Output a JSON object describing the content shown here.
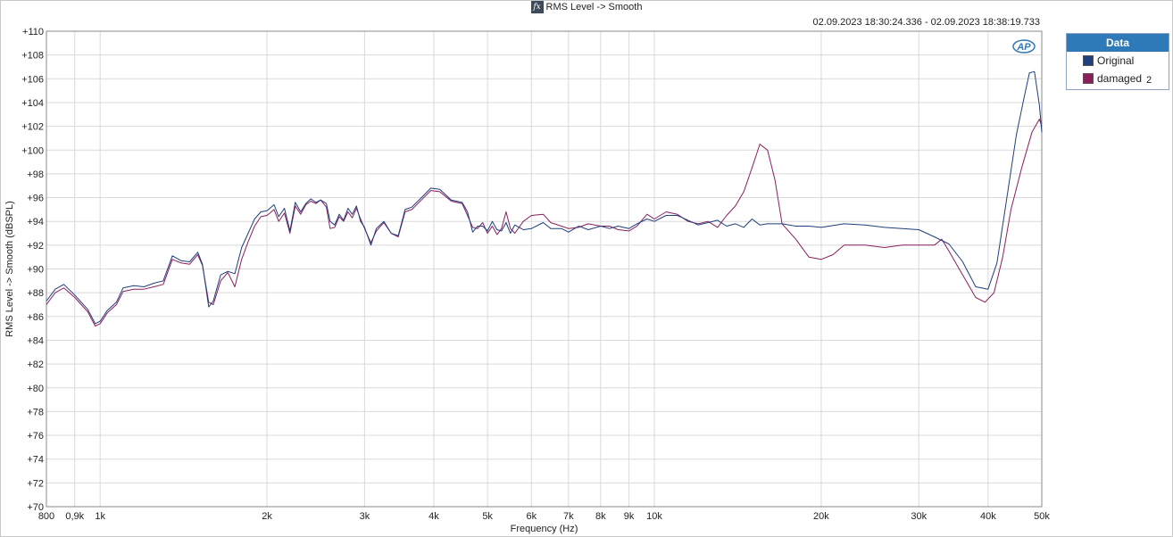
{
  "window": {
    "title": "RMS Level -> Smooth",
    "time_range": "02.09.2023 18:30:24.336 - 02.09.2023 18:38:19.733",
    "fx_icon": "fx-icon"
  },
  "legend": {
    "header": "Data",
    "items": [
      {
        "label": "Original",
        "suffix": "",
        "color": "#1f3e7c"
      },
      {
        "label": "damaged",
        "suffix": "2",
        "color": "#8a1f5e"
      }
    ]
  },
  "logo": {
    "text": "AP",
    "color": "#2e7ab8"
  },
  "chart_data": {
    "type": "line",
    "xlabel": "Frequency (Hz)",
    "ylabel": "RMS Level -> Smooth (dBSPL)",
    "xscale": "log",
    "xlim": [
      800,
      50000
    ],
    "ylim": [
      70,
      110
    ],
    "grid": true,
    "legend_position": "right",
    "x_ticks": [
      {
        "value": 800,
        "label": "800"
      },
      {
        "value": 900,
        "label": "0,9k"
      },
      {
        "value": 1000,
        "label": "1k"
      },
      {
        "value": 2000,
        "label": "2k"
      },
      {
        "value": 3000,
        "label": "3k"
      },
      {
        "value": 4000,
        "label": "4k"
      },
      {
        "value": 5000,
        "label": "5k"
      },
      {
        "value": 6000,
        "label": "6k"
      },
      {
        "value": 7000,
        "label": "7k"
      },
      {
        "value": 8000,
        "label": "8k"
      },
      {
        "value": 9000,
        "label": "9k"
      },
      {
        "value": 10000,
        "label": "10k"
      },
      {
        "value": 20000,
        "label": "20k"
      },
      {
        "value": 30000,
        "label": "30k"
      },
      {
        "value": 40000,
        "label": "40k"
      },
      {
        "value": 50000,
        "label": "50k"
      }
    ],
    "y_ticks": [
      {
        "value": 110,
        "label": "+110"
      },
      {
        "value": 108,
        "label": "+108"
      },
      {
        "value": 106,
        "label": "+106"
      },
      {
        "value": 104,
        "label": "+104"
      },
      {
        "value": 102,
        "label": "+102"
      },
      {
        "value": 100,
        "label": "+100"
      },
      {
        "value": 98,
        "label": "+98"
      },
      {
        "value": 96,
        "label": "+96"
      },
      {
        "value": 94,
        "label": "+94"
      },
      {
        "value": 92,
        "label": "+92"
      },
      {
        "value": 90,
        "label": "+90"
      },
      {
        "value": 88,
        "label": "+88"
      },
      {
        "value": 86,
        "label": "+86"
      },
      {
        "value": 84,
        "label": "+84"
      },
      {
        "value": 82,
        "label": "+82"
      },
      {
        "value": 80,
        "label": "+80"
      },
      {
        "value": 78,
        "label": "+78"
      },
      {
        "value": 76,
        "label": "+76"
      },
      {
        "value": 74,
        "label": "+74"
      },
      {
        "value": 72,
        "label": "+72"
      },
      {
        "value": 70,
        "label": "+70"
      }
    ],
    "series": [
      {
        "name": "Original",
        "color": "#1f3e7c",
        "points": [
          [
            800,
            87.3
          ],
          [
            830,
            88.3
          ],
          [
            860,
            88.7
          ],
          [
            900,
            87.8
          ],
          [
            950,
            86.6
          ],
          [
            980,
            85.4
          ],
          [
            1000,
            85.6
          ],
          [
            1030,
            86.5
          ],
          [
            1070,
            87.2
          ],
          [
            1100,
            88.4
          ],
          [
            1150,
            88.6
          ],
          [
            1200,
            88.5
          ],
          [
            1250,
            88.8
          ],
          [
            1300,
            89.0
          ],
          [
            1350,
            91.1
          ],
          [
            1400,
            90.7
          ],
          [
            1450,
            90.6
          ],
          [
            1500,
            91.4
          ],
          [
            1530,
            90.4
          ],
          [
            1570,
            86.8
          ],
          [
            1600,
            87.3
          ],
          [
            1650,
            89.5
          ],
          [
            1700,
            89.8
          ],
          [
            1750,
            89.6
          ],
          [
            1800,
            91.8
          ],
          [
            1850,
            93.0
          ],
          [
            1900,
            94.2
          ],
          [
            1950,
            94.8
          ],
          [
            2000,
            94.9
          ],
          [
            2060,
            95.4
          ],
          [
            2100,
            94.4
          ],
          [
            2150,
            95.1
          ],
          [
            2200,
            93.2
          ],
          [
            2250,
            95.6
          ],
          [
            2300,
            94.8
          ],
          [
            2350,
            95.5
          ],
          [
            2400,
            95.9
          ],
          [
            2450,
            95.6
          ],
          [
            2500,
            95.8
          ],
          [
            2560,
            95.5
          ],
          [
            2600,
            94.0
          ],
          [
            2650,
            93.7
          ],
          [
            2700,
            94.6
          ],
          [
            2750,
            94.1
          ],
          [
            2800,
            95.1
          ],
          [
            2850,
            94.6
          ],
          [
            2900,
            95.3
          ],
          [
            2950,
            94.0
          ],
          [
            3000,
            93.5
          ],
          [
            3080,
            92.0
          ],
          [
            3150,
            93.4
          ],
          [
            3250,
            94.0
          ],
          [
            3350,
            93.0
          ],
          [
            3450,
            92.8
          ],
          [
            3550,
            95.0
          ],
          [
            3650,
            95.2
          ],
          [
            3800,
            96.0
          ],
          [
            3950,
            96.8
          ],
          [
            4100,
            96.7
          ],
          [
            4300,
            95.8
          ],
          [
            4500,
            95.6
          ],
          [
            4600,
            94.8
          ],
          [
            4700,
            93.1
          ],
          [
            4800,
            93.6
          ],
          [
            4900,
            93.6
          ],
          [
            5000,
            93.2
          ],
          [
            5100,
            94.0
          ],
          [
            5200,
            93.3
          ],
          [
            5300,
            93.2
          ],
          [
            5400,
            93.9
          ],
          [
            5500,
            93.0
          ],
          [
            5600,
            93.7
          ],
          [
            5800,
            93.3
          ],
          [
            6000,
            93.4
          ],
          [
            6300,
            93.9
          ],
          [
            6500,
            93.4
          ],
          [
            6800,
            93.4
          ],
          [
            7000,
            93.1
          ],
          [
            7300,
            93.6
          ],
          [
            7600,
            93.3
          ],
          [
            8000,
            93.6
          ],
          [
            8300,
            93.4
          ],
          [
            8600,
            93.6
          ],
          [
            9000,
            93.4
          ],
          [
            9300,
            93.8
          ],
          [
            9700,
            94.2
          ],
          [
            10000,
            94.0
          ],
          [
            10500,
            94.5
          ],
          [
            11000,
            94.5
          ],
          [
            11500,
            94.1
          ],
          [
            12000,
            93.7
          ],
          [
            12500,
            93.9
          ],
          [
            13000,
            94.1
          ],
          [
            13500,
            93.6
          ],
          [
            14000,
            93.8
          ],
          [
            14500,
            93.5
          ],
          [
            15000,
            94.2
          ],
          [
            15500,
            93.7
          ],
          [
            16000,
            93.8
          ],
          [
            17000,
            93.8
          ],
          [
            18000,
            93.6
          ],
          [
            19000,
            93.6
          ],
          [
            20000,
            93.5
          ],
          [
            22000,
            93.8
          ],
          [
            24000,
            93.7
          ],
          [
            26000,
            93.5
          ],
          [
            28000,
            93.4
          ],
          [
            30000,
            93.3
          ],
          [
            32000,
            92.7
          ],
          [
            34000,
            92.1
          ],
          [
            36000,
            90.6
          ],
          [
            38000,
            88.5
          ],
          [
            40000,
            88.3
          ],
          [
            41500,
            90.5
          ],
          [
            43000,
            95.2
          ],
          [
            45000,
            101.3
          ],
          [
            46500,
            104.5
          ],
          [
            47500,
            106.5
          ],
          [
            48500,
            106.6
          ],
          [
            49500,
            103.8
          ],
          [
            50000,
            101.5
          ]
        ]
      },
      {
        "name": "damaged 2",
        "color": "#8a1f5e",
        "points": [
          [
            800,
            87.0
          ],
          [
            830,
            88.0
          ],
          [
            860,
            88.4
          ],
          [
            900,
            87.6
          ],
          [
            950,
            86.4
          ],
          [
            980,
            85.2
          ],
          [
            1000,
            85.4
          ],
          [
            1030,
            86.3
          ],
          [
            1070,
            87.0
          ],
          [
            1100,
            88.1
          ],
          [
            1150,
            88.3
          ],
          [
            1200,
            88.3
          ],
          [
            1250,
            88.5
          ],
          [
            1300,
            88.7
          ],
          [
            1350,
            90.8
          ],
          [
            1400,
            90.5
          ],
          [
            1450,
            90.4
          ],
          [
            1500,
            91.2
          ],
          [
            1530,
            90.3
          ],
          [
            1570,
            87.2
          ],
          [
            1600,
            87.0
          ],
          [
            1650,
            89.0
          ],
          [
            1700,
            89.7
          ],
          [
            1750,
            88.5
          ],
          [
            1800,
            90.8
          ],
          [
            1850,
            92.3
          ],
          [
            1900,
            93.6
          ],
          [
            1950,
            94.4
          ],
          [
            2000,
            94.5
          ],
          [
            2060,
            95.0
          ],
          [
            2100,
            94.0
          ],
          [
            2150,
            94.7
          ],
          [
            2200,
            93.0
          ],
          [
            2250,
            95.3
          ],
          [
            2300,
            94.6
          ],
          [
            2350,
            95.4
          ],
          [
            2400,
            95.7
          ],
          [
            2450,
            95.5
          ],
          [
            2500,
            95.8
          ],
          [
            2560,
            95.2
          ],
          [
            2600,
            93.4
          ],
          [
            2650,
            93.5
          ],
          [
            2700,
            94.4
          ],
          [
            2750,
            94.0
          ],
          [
            2800,
            94.8
          ],
          [
            2850,
            94.3
          ],
          [
            2900,
            95.1
          ],
          [
            2950,
            94.2
          ],
          [
            3000,
            93.4
          ],
          [
            3080,
            92.2
          ],
          [
            3150,
            93.2
          ],
          [
            3250,
            93.9
          ],
          [
            3350,
            93.0
          ],
          [
            3450,
            92.7
          ],
          [
            3550,
            94.8
          ],
          [
            3650,
            95.0
          ],
          [
            3800,
            95.8
          ],
          [
            3950,
            96.6
          ],
          [
            4100,
            96.5
          ],
          [
            4300,
            95.7
          ],
          [
            4500,
            95.5
          ],
          [
            4600,
            94.5
          ],
          [
            4700,
            93.5
          ],
          [
            4800,
            93.4
          ],
          [
            4900,
            93.9
          ],
          [
            5000,
            93.0
          ],
          [
            5100,
            93.6
          ],
          [
            5200,
            92.9
          ],
          [
            5300,
            93.4
          ],
          [
            5400,
            94.8
          ],
          [
            5500,
            93.4
          ],
          [
            5600,
            93.0
          ],
          [
            5800,
            94.0
          ],
          [
            6000,
            94.5
          ],
          [
            6300,
            94.6
          ],
          [
            6500,
            93.9
          ],
          [
            6800,
            93.6
          ],
          [
            7000,
            93.4
          ],
          [
            7300,
            93.5
          ],
          [
            7600,
            93.8
          ],
          [
            8000,
            93.6
          ],
          [
            8300,
            93.6
          ],
          [
            8600,
            93.3
          ],
          [
            9000,
            93.2
          ],
          [
            9300,
            93.6
          ],
          [
            9700,
            94.6
          ],
          [
            10000,
            94.2
          ],
          [
            10500,
            94.8
          ],
          [
            11000,
            94.6
          ],
          [
            11500,
            94.0
          ],
          [
            12000,
            93.8
          ],
          [
            12500,
            94.0
          ],
          [
            13000,
            93.5
          ],
          [
            13500,
            94.5
          ],
          [
            14000,
            95.3
          ],
          [
            14500,
            96.5
          ],
          [
            15000,
            98.5
          ],
          [
            15500,
            100.5
          ],
          [
            16000,
            100.0
          ],
          [
            16500,
            97.5
          ],
          [
            17000,
            93.8
          ],
          [
            18000,
            92.5
          ],
          [
            19000,
            91.0
          ],
          [
            20000,
            90.8
          ],
          [
            21000,
            91.2
          ],
          [
            22000,
            92.0
          ],
          [
            24000,
            92.0
          ],
          [
            26000,
            91.8
          ],
          [
            28000,
            92.0
          ],
          [
            30000,
            92.0
          ],
          [
            32000,
            92.0
          ],
          [
            33000,
            92.5
          ],
          [
            34000,
            91.5
          ],
          [
            36000,
            89.5
          ],
          [
            38000,
            87.6
          ],
          [
            39500,
            87.2
          ],
          [
            41000,
            88.0
          ],
          [
            42500,
            91.0
          ],
          [
            44000,
            95.0
          ],
          [
            46000,
            98.5
          ],
          [
            48000,
            101.5
          ],
          [
            49500,
            102.6
          ],
          [
            50000,
            102.0
          ]
        ]
      }
    ]
  }
}
